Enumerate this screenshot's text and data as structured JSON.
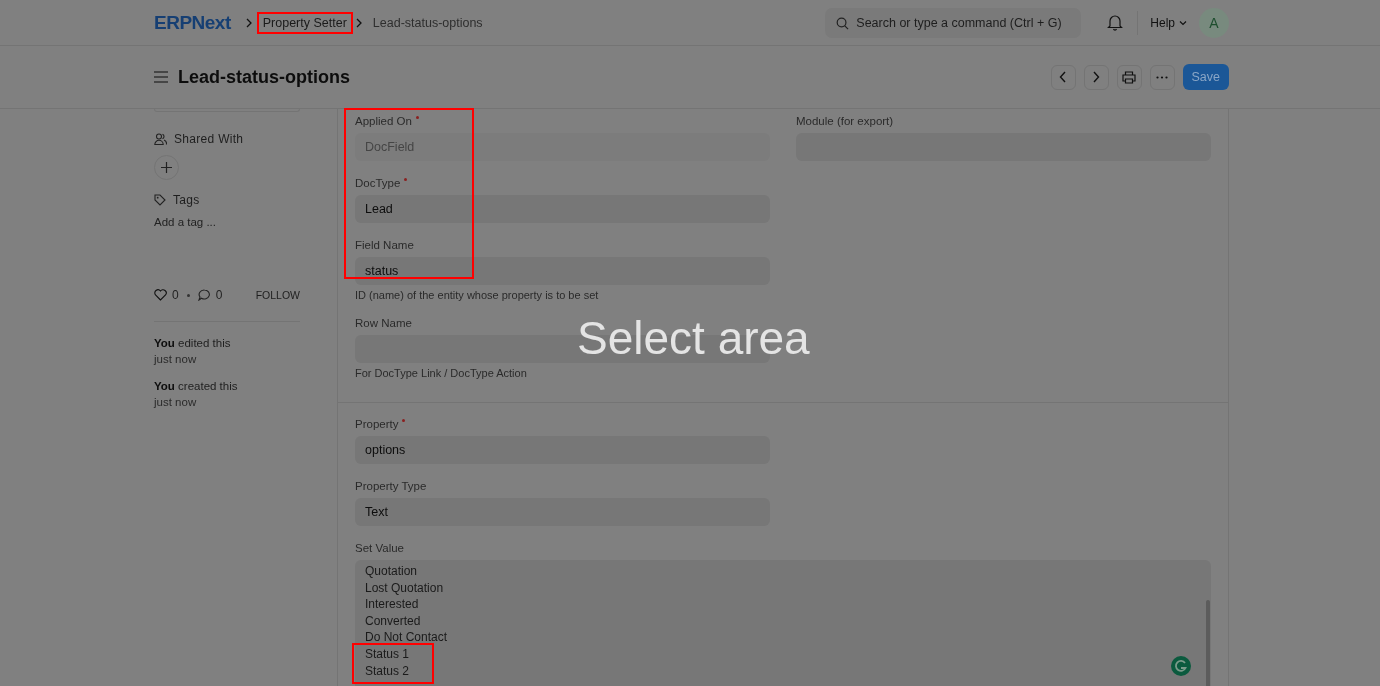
{
  "topbar": {
    "logo": "ERPNext",
    "breadcrumbs": [
      {
        "label": "Property Setter",
        "highlighted": true
      },
      {
        "label": "Lead-status-options",
        "highlighted": false
      }
    ],
    "search": {
      "placeholder": "Search or type a command (Ctrl + G)"
    },
    "help": "Help",
    "avatar": "A"
  },
  "header": {
    "title": "Lead-status-options",
    "save": "Save"
  },
  "sidebar": {
    "shared_with": "Shared With",
    "tags": "Tags",
    "add_tag": "Add a tag ...",
    "likes": "0",
    "comments": "0",
    "follow": "FOLLOW",
    "activity": [
      {
        "action": "**You** edited this",
        "when": "just now"
      },
      {
        "action": "**You** created this",
        "when": "just now"
      }
    ]
  },
  "sections": [
    {
      "left": [
        {
          "kind": "input",
          "label": "Applied On",
          "required": true,
          "value": "DocField",
          "read_only": true,
          "highlighted": true
        },
        {
          "kind": "input",
          "label": "DocType",
          "required": true,
          "value": "Lead",
          "read_only": false,
          "highlighted": true
        },
        {
          "kind": "input",
          "label": "Field Name",
          "required": false,
          "value": "status",
          "read_only": false,
          "highlighted": true,
          "description": "ID (name) of the entity whose property is to be set"
        },
        {
          "kind": "input",
          "label": "Row Name",
          "required": false,
          "highlighted": false,
          "description": "For DocType Link / DocType Action"
        }
      ],
      "right": [
        {
          "kind": "input",
          "label": "Module (for export)",
          "required": false,
          "highlighted": false
        }
      ]
    },
    {
      "left": [
        {
          "kind": "input",
          "label": "Property",
          "required": true,
          "value": "options",
          "read_only": false,
          "highlighted": false
        },
        {
          "kind": "input",
          "label": "Property Type",
          "required": false,
          "value": "Text",
          "read_only": false,
          "highlighted": false
        },
        {
          "kind": "textarea",
          "label": "Set Value",
          "required": false,
          "read_only": false,
          "highlighted": false,
          "lines": [
            {
              "text": "Quotation",
              "highlighted": false
            },
            {
              "text": "Lost Quotation",
              "highlighted": false
            },
            {
              "text": "Interested",
              "highlighted": false
            },
            {
              "text": "Converted",
              "highlighted": false
            },
            {
              "text": "Do Not Contact",
              "highlighted": false
            },
            {
              "text": "Status 1",
              "highlighted": true
            },
            {
              "text": "Status 2",
              "highlighted": true
            }
          ]
        }
      ]
    }
  ],
  "overlay": {
    "text": "Select area"
  }
}
